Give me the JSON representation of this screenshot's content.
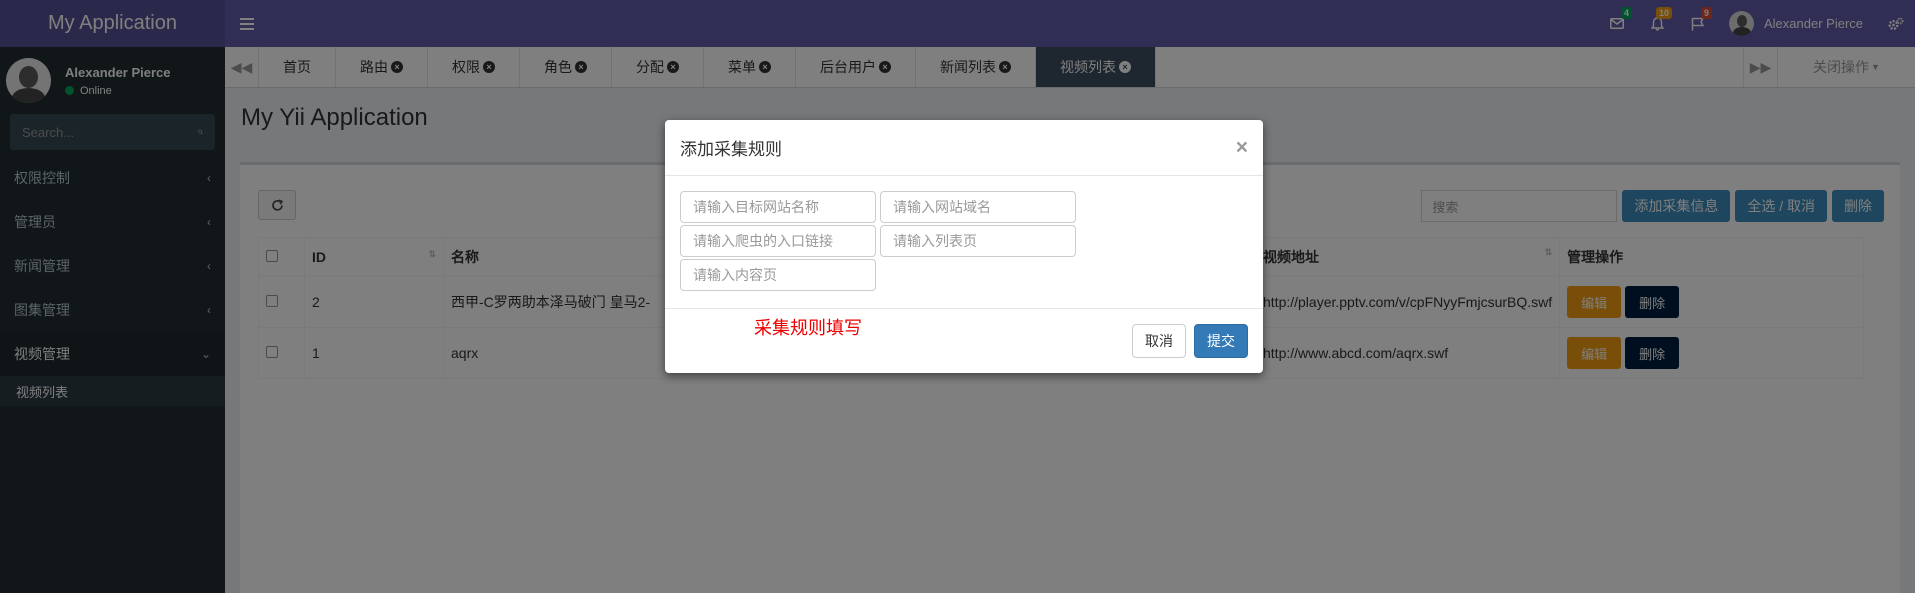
{
  "app": {
    "title": "My Application"
  },
  "header": {
    "toggle_icon": "hamburger-icon",
    "messages_count": "4",
    "notifications_count": "10",
    "tasks_count": "9",
    "user_name": "Alexander Pierce",
    "colors": {
      "messages_badge": "#00a65a",
      "notifications_badge": "#f39c12",
      "tasks_badge": "#dd4b39"
    }
  },
  "sidebar": {
    "user_name": "Alexander Pierce",
    "status": "Online",
    "search_placeholder": "Search...",
    "items": [
      {
        "label": "权限控制"
      },
      {
        "label": "管理员"
      },
      {
        "label": "新闻管理"
      },
      {
        "label": "图集管理"
      },
      {
        "label": "视频管理"
      }
    ],
    "sub_item": "视频列表"
  },
  "tabs": {
    "items": [
      {
        "label": "首页"
      },
      {
        "label": "路由"
      },
      {
        "label": "权限"
      },
      {
        "label": "角色"
      },
      {
        "label": "分配"
      },
      {
        "label": "菜单"
      },
      {
        "label": "后台用户"
      },
      {
        "label": "新闻列表"
      },
      {
        "label": "视频列表"
      }
    ],
    "close_ops": "关闭操作"
  },
  "main": {
    "page_title": "My Yii Application",
    "search_placeholder": "搜索",
    "add_button": "添加采集信息",
    "select_all_button": "全选 / 取消",
    "delete_button": "删除",
    "columns": {
      "id": "ID",
      "name": "名称",
      "url": "视频地址",
      "ops": "管理操作"
    },
    "rows": [
      {
        "id": "2",
        "name": "西甲-C罗两助本泽马破门 皇马2-",
        "url": "http://player.pptv.com/v/cpFNyyFmjcsurBQ.swf",
        "edit": "编辑",
        "delete": "删除"
      },
      {
        "id": "1",
        "name": "aqrx",
        "url": "http://www.abcd.com/aqrx.swf",
        "edit": "编辑",
        "delete": "删除"
      }
    ]
  },
  "modal": {
    "title": "添加采集规则",
    "close": "×",
    "fields": {
      "site_name": "请输入目标网站名称",
      "domain": "请输入网站域名",
      "entry_url": "请输入爬虫的入口链接",
      "list_page": "请输入列表页",
      "content_page": "请输入内容页"
    },
    "note": "采集规则填写",
    "cancel": "取消",
    "submit": "提交"
  }
}
